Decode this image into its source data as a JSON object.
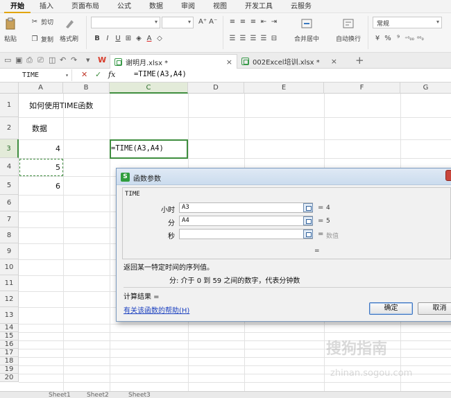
{
  "menu": {
    "tabs": [
      "开始",
      "插入",
      "页面布局",
      "公式",
      "数据",
      "审阅",
      "视图",
      "开发工具",
      "云服务"
    ],
    "active": "开始"
  },
  "ribbon": {
    "paste": "粘贴",
    "cut": "剪切",
    "copy": "复制",
    "format_painter": "格式刷",
    "bold": "B",
    "italic": "I",
    "underline": "U",
    "font_grow": "A⁺",
    "font_shrink": "A⁻",
    "merge_center": "合并居中",
    "wrap_text": "自动换行",
    "number_format": "常规",
    "percent": "%",
    "thousands": "⁹",
    "inc_decimal": "+.0\n.00",
    "dec_decimal": ".00\n→.0"
  },
  "doc_tabs": [
    {
      "label": "谢明月.xlsx *",
      "active": true
    },
    {
      "label": "002Excel培训.xlsx *",
      "active": false
    }
  ],
  "formula_bar": {
    "name_box": "TIME",
    "fx": "fx",
    "formula": "=TIME(A3,A4)"
  },
  "columns": [
    "A",
    "B",
    "C",
    "D",
    "E",
    "F",
    "G"
  ],
  "rows": [
    "1",
    "2",
    "3",
    "4",
    "5",
    "6",
    "7",
    "8",
    "9",
    "10",
    "11",
    "12",
    "13",
    "14",
    "15",
    "16",
    "17",
    "18",
    "19",
    "20"
  ],
  "cells": {
    "A1": "如何使用TIME函数",
    "A2": "数据",
    "A3": "4",
    "A4": "5",
    "A5": "6",
    "C3": "=TIME(A3,A4)"
  },
  "dialog": {
    "title": "函数参数",
    "function_name": "TIME",
    "args": [
      {
        "label": "小时",
        "value": "A3",
        "result": "4",
        "placeholder": false
      },
      {
        "label": "分",
        "value": "A4",
        "result": "5",
        "placeholder": false
      },
      {
        "label": "秒",
        "value": "",
        "result": "数值",
        "placeholder": true
      }
    ],
    "equals": "=",
    "description": "返回某一特定时间的序列值。",
    "arg_description": "分:  介于 0 到 59 之间的数字，代表分钟数",
    "result_label": "计算结果 =",
    "help_link": "有关该函数的帮助(H)",
    "ok": "确定",
    "cancel": "取消"
  },
  "sheet_tabs": [
    "Sheet1",
    "Sheet2",
    "Sheet3"
  ],
  "watermark": {
    "line1": "搜狗指南",
    "line2": "zhinan.sogou.com"
  },
  "colors": {
    "accent_green": "#3e8d3e",
    "active_tab_underline": "#e2a500",
    "link": "#1a3fbf"
  }
}
